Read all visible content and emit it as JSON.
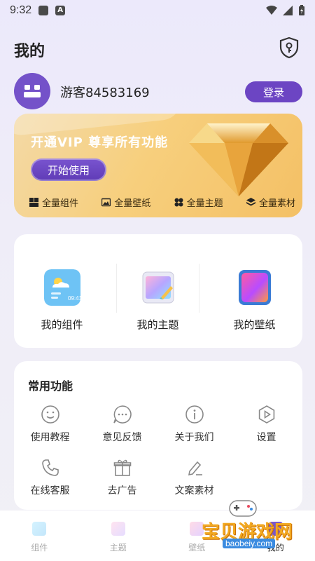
{
  "status_bar": {
    "time": "9:32",
    "a_icon": "A"
  },
  "header": {
    "title": "我的"
  },
  "profile": {
    "username": "游客84583169",
    "login_label": "登录"
  },
  "vip": {
    "title": "开通VIP 尊享所有功能",
    "start_label": "开始使用",
    "features": [
      {
        "label": "全量组件",
        "icon": "widget-icon"
      },
      {
        "label": "全量壁纸",
        "icon": "image-icon"
      },
      {
        "label": "全量主题",
        "icon": "theme-icon"
      },
      {
        "label": "全量素材",
        "icon": "layers-icon"
      }
    ]
  },
  "mine": {
    "items": [
      {
        "label": "我的组件",
        "icon": "weather-widget-icon"
      },
      {
        "label": "我的主题",
        "icon": "paint-theme-icon"
      },
      {
        "label": "我的壁纸",
        "icon": "phone-wallpaper-icon"
      }
    ]
  },
  "common": {
    "title": "常用功能",
    "items": [
      {
        "label": "使用教程",
        "icon": "smile-icon"
      },
      {
        "label": "意见反馈",
        "icon": "chat-icon"
      },
      {
        "label": "关于我们",
        "icon": "info-icon"
      },
      {
        "label": "设置",
        "icon": "play-settings-icon"
      },
      {
        "label": "在线客服",
        "icon": "phone-icon"
      },
      {
        "label": "去广告",
        "icon": "gift-icon"
      },
      {
        "label": "文案素材",
        "icon": "pen-icon"
      }
    ]
  },
  "tabbar": {
    "tabs": [
      {
        "label": "组件"
      },
      {
        "label": "主题"
      },
      {
        "label": "壁纸"
      },
      {
        "label": "我的"
      }
    ]
  },
  "watermark": {
    "text": "宝贝游戏网",
    "url": "baobeiy.com"
  },
  "colors": {
    "accent": "#6c45c3",
    "vip_gold": "#f4c065"
  }
}
